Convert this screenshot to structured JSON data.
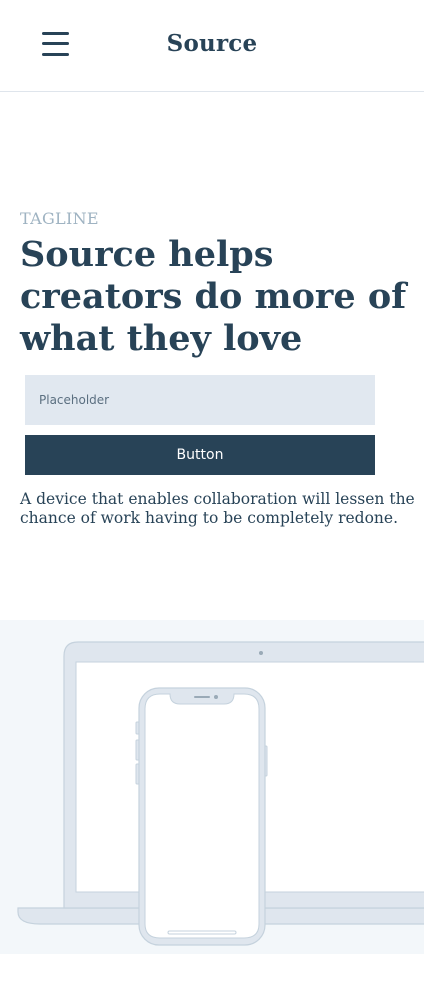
{
  "header": {
    "brand": "Source",
    "menu_icon": "hamburger-menu-icon"
  },
  "hero": {
    "tagline": "TAGLINE",
    "title": "Source helps creators do more of what they love",
    "input_placeholder": "Placeholder",
    "button_label": "Button",
    "description": "A device that enables collaboration will lessen the chance of work having to be completely redone."
  },
  "illustration": {
    "devices": [
      "laptop-illustration",
      "phone-illustration"
    ],
    "colors": {
      "background": "#f3f7fa",
      "device_fill": "#dfe6ee",
      "device_stroke": "#c5d2dd",
      "screen": "#ffffff"
    }
  },
  "theme": {
    "primary": "#284357",
    "muted": "#9fb3c2",
    "input_bg": "#e1e8f0"
  }
}
